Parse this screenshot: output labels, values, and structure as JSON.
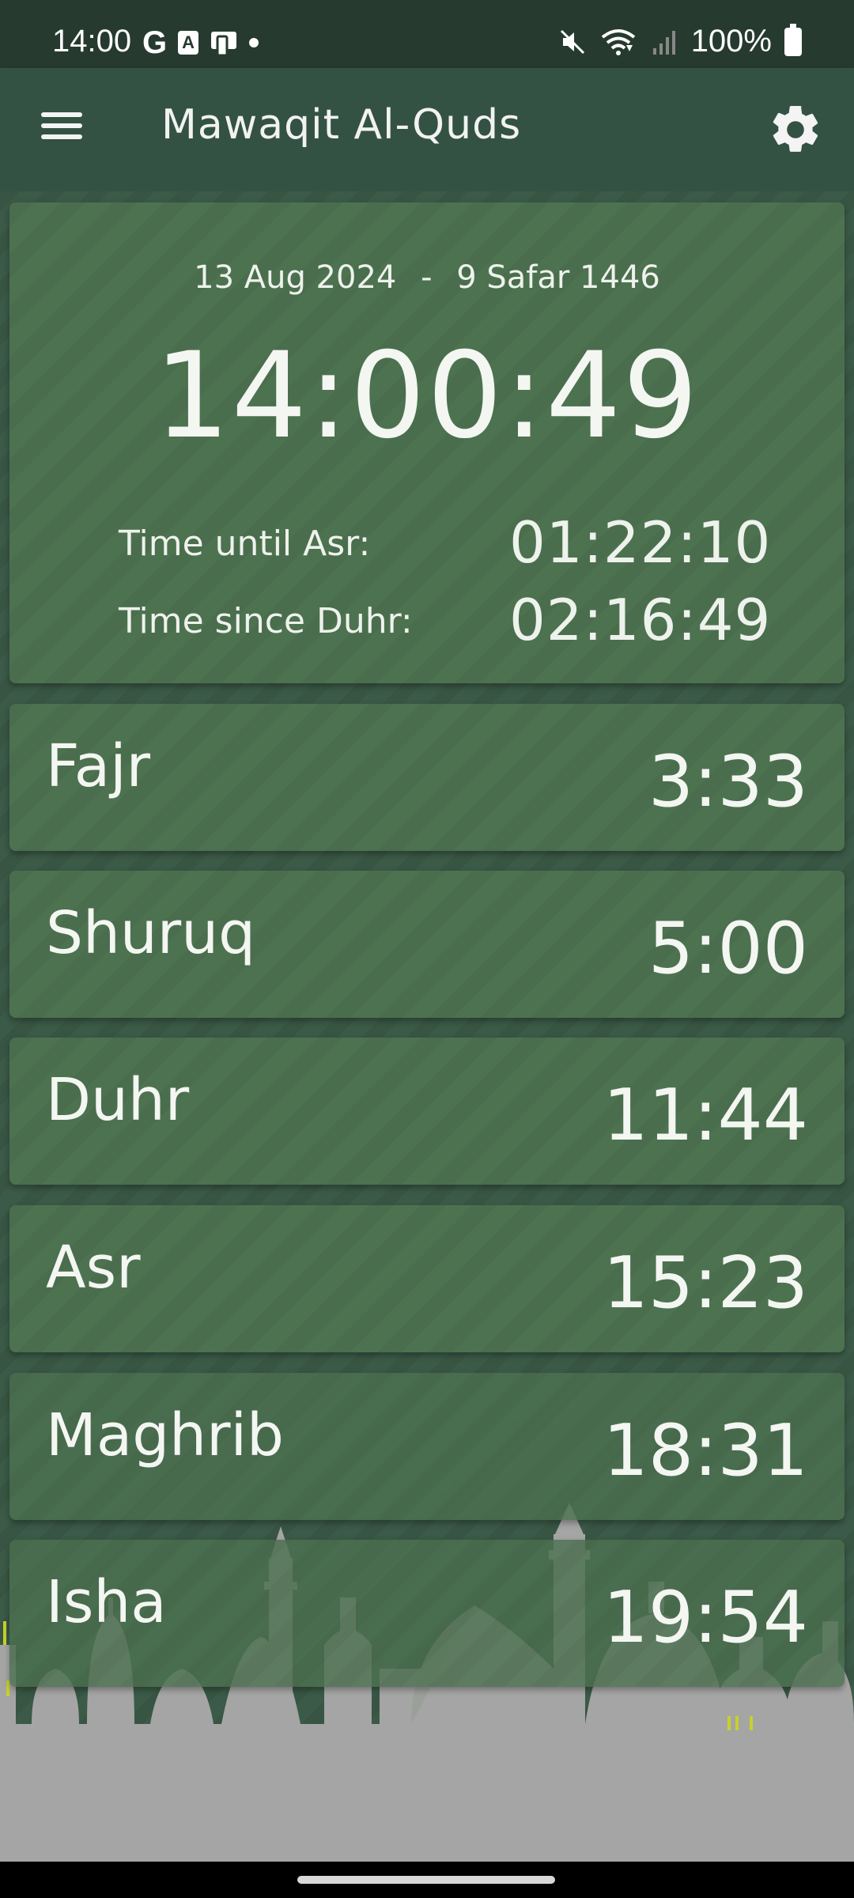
{
  "status_bar": {
    "time": "14:00",
    "battery": "100%",
    "icons": [
      "google-icon",
      "a-box-icon",
      "device-icon",
      "dot-icon",
      "mute-icon",
      "wifi-icon",
      "signal-icon",
      "battery-icon"
    ]
  },
  "app_bar": {
    "title": "Mawaqit Al-Quds",
    "menu_icon": "hamburger-menu-icon",
    "settings_icon": "gear-icon"
  },
  "clock": {
    "gregorian_date": "13 Aug 2024",
    "separator": "-",
    "hijri_date": "9 Safar 1446",
    "current_time": "14:00:49",
    "until_label": "Time until Asr:",
    "until_value": "01:22:10",
    "since_label": "Time since Duhr:",
    "since_value": "02:16:49"
  },
  "prayers": [
    {
      "name": "Fajr",
      "time": "3:33"
    },
    {
      "name": "Shuruq",
      "time": "5:00"
    },
    {
      "name": "Duhr",
      "time": "11:44"
    },
    {
      "name": "Asr",
      "time": "15:23"
    },
    {
      "name": "Maghrib",
      "time": "18:31"
    },
    {
      "name": "Isha",
      "time": "19:54"
    }
  ],
  "colors": {
    "status_bar": "#263a30",
    "app_bar": "#345244",
    "card": "#4d7250",
    "background": "#3b5a47",
    "skyline": "#a5a5a5"
  }
}
